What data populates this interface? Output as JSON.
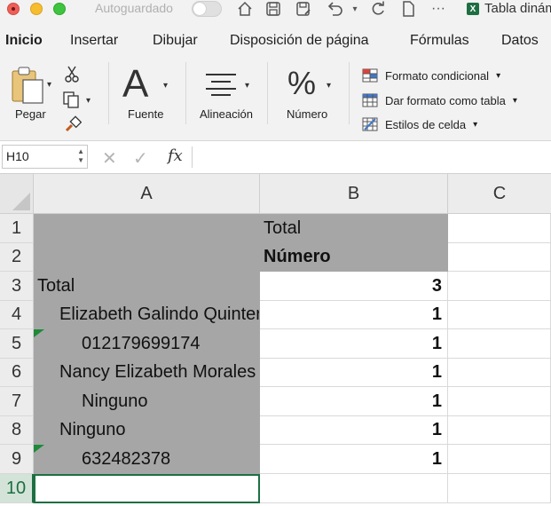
{
  "titlebar": {
    "autosave_label": "Autoguardado",
    "document_title": "Tabla dinámica",
    "app_icon_letter": "X"
  },
  "ribbon": {
    "tabs": [
      "Inicio",
      "Insertar",
      "Dibujar",
      "Disposición de página",
      "Fórmulas",
      "Datos"
    ],
    "active_tab": "Inicio",
    "groups": {
      "paste": "Pegar",
      "font": "Fuente",
      "font_glyph": "A",
      "alignment": "Alineación",
      "number": "Número",
      "number_glyph": "%"
    },
    "styles": {
      "conditional_format": "Formato condicional",
      "format_as_table": "Dar formato como tabla",
      "cell_styles": "Estilos de celda"
    }
  },
  "formula_bar": {
    "name_box": "H10",
    "fx_label": "fx",
    "formula": ""
  },
  "sheet": {
    "columns": [
      "A",
      "B",
      "C"
    ],
    "rows": [
      {
        "num": "1",
        "a": "",
        "b": "Total"
      },
      {
        "num": "2",
        "a": "",
        "b": "Número"
      },
      {
        "num": "3",
        "a": "Total",
        "b": "3"
      },
      {
        "num": "4",
        "a": "Elizabeth Galindo Quintero",
        "b": "1"
      },
      {
        "num": "5",
        "a": "012179699174",
        "b": "1"
      },
      {
        "num": "6",
        "a": "Nancy Elizabeth Morales",
        "b": "1"
      },
      {
        "num": "7",
        "a": "Ninguno",
        "b": "1"
      },
      {
        "num": "8",
        "a": "Ninguno",
        "b": "1"
      },
      {
        "num": "9",
        "a": "632482378",
        "b": "1"
      },
      {
        "num": "10",
        "a": "",
        "b": ""
      }
    ]
  },
  "colors": {
    "accent": "#1d6f42",
    "pivot_fill": "#a6a6a6",
    "error_flag": "#1d8a3a"
  }
}
